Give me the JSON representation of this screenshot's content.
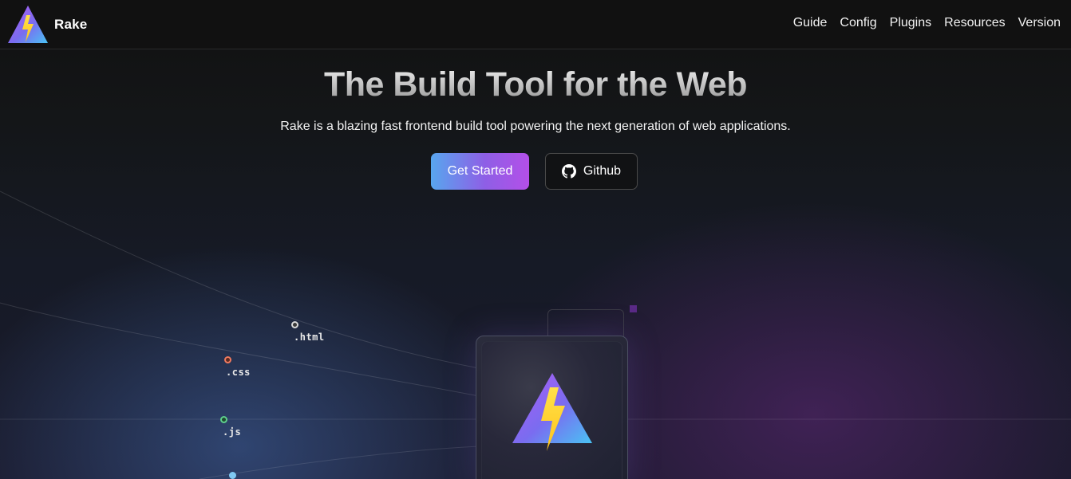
{
  "header": {
    "brand_name": "Rake",
    "nav": [
      {
        "label": "Guide"
      },
      {
        "label": "Config"
      },
      {
        "label": "Plugins"
      },
      {
        "label": "Resources"
      },
      {
        "label": "Version"
      }
    ]
  },
  "hero": {
    "title": "The Build Tool for the Web",
    "subtitle": "Rake is a blazing fast frontend build tool powering the next generation of web applications.",
    "primary_button": "Get Started",
    "secondary_button": "Github"
  },
  "file_types": [
    {
      "label": ".html",
      "color": "#d8d8d8"
    },
    {
      "label": ".css",
      "color": "#f07a5e"
    },
    {
      "label": ".js",
      "color": "#5fd08c"
    },
    {
      "label": "",
      "color": "#7fc9f2"
    }
  ],
  "colors": {
    "accent_start": "#58a6ee",
    "accent_end": "#b44fe8",
    "logo_purple": "#9a5cf0",
    "logo_blue": "#4ec0f5",
    "logo_yellow": "#ffd21e"
  },
  "icons": {
    "brand": "rake-logo-icon",
    "github": "github-icon"
  }
}
